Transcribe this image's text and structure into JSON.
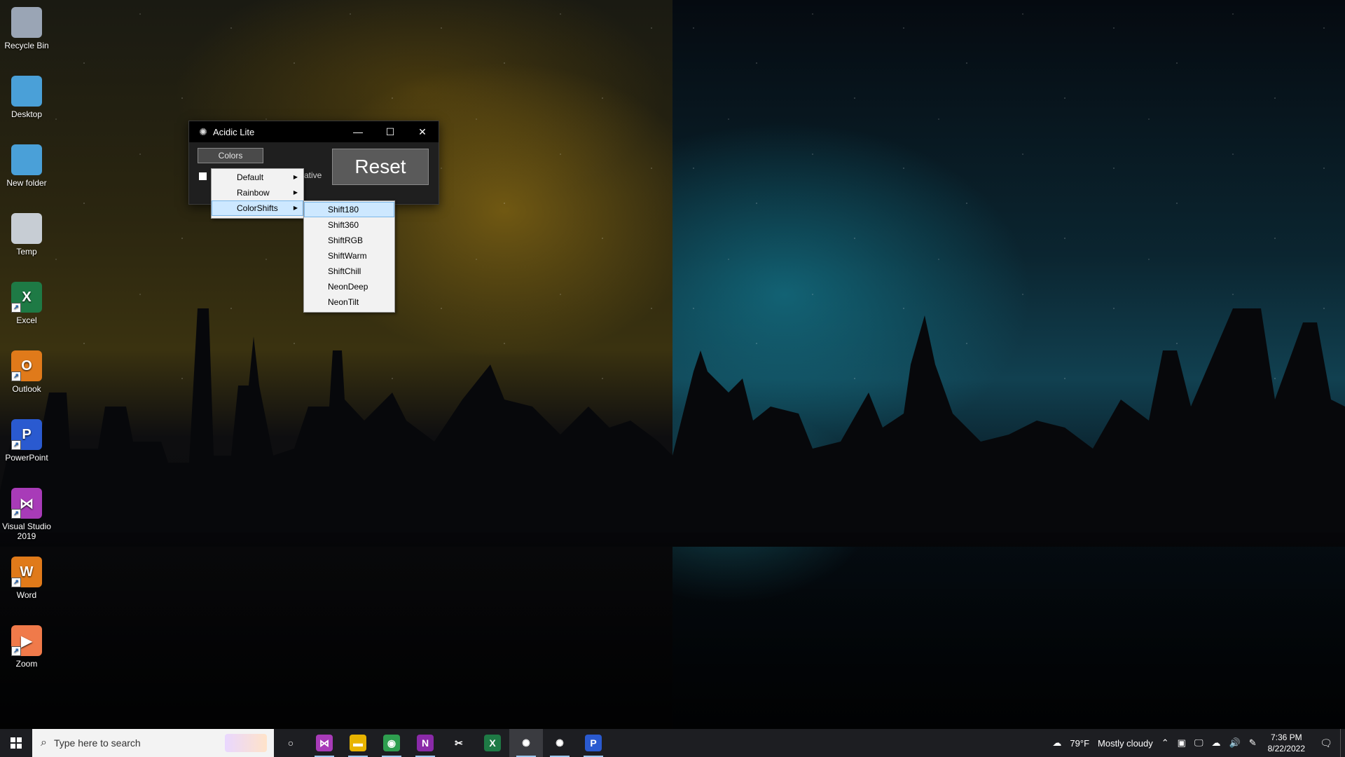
{
  "desktop": {
    "icons": [
      {
        "label": "Recycle Bin",
        "icon": "recycle-bin-icon",
        "color": "#9aa5b5"
      },
      {
        "label": "Desktop",
        "icon": "folder-icon",
        "color": "#4aa0d8"
      },
      {
        "label": "New folder",
        "icon": "folder-icon",
        "color": "#4aa0d8"
      },
      {
        "label": "Temp",
        "icon": "folder-icon",
        "color": "#c7cdd4"
      },
      {
        "label": "Excel",
        "icon": "excel-icon",
        "color": "#1e7a45",
        "glyph": "X"
      },
      {
        "label": "Outlook",
        "icon": "outlook-icon",
        "color": "#e07a1a",
        "glyph": "O"
      },
      {
        "label": "PowerPoint",
        "icon": "powerpoint-icon",
        "color": "#2a5ad0",
        "glyph": "P"
      },
      {
        "label": "Visual Studio\n2019",
        "icon": "visual-studio-icon",
        "color": "#a83bb8",
        "glyph": "⋈"
      },
      {
        "label": "Word",
        "icon": "word-icon",
        "color": "#e07a1a",
        "glyph": "W"
      },
      {
        "label": "Zoom",
        "icon": "zoom-icon",
        "color": "#f07a4a",
        "glyph": "▶"
      }
    ]
  },
  "window": {
    "title": "Acidic Lite",
    "app_icon": "acidic-lite-icon",
    "minimize_glyph": "—",
    "maximize_glyph": "☐",
    "close_glyph": "✕",
    "colors_button": "Colors",
    "negative_label": "ative",
    "negative_checked": false,
    "reset_button": "Reset"
  },
  "menu_colors": {
    "items": [
      {
        "label": "Default",
        "has_submenu": true,
        "selected": false
      },
      {
        "label": "Rainbow",
        "has_submenu": true,
        "selected": false
      },
      {
        "label": "ColorShifts",
        "has_submenu": true,
        "selected": true
      }
    ]
  },
  "menu_colorshifts": {
    "items": [
      {
        "label": "Shift180",
        "selected": true
      },
      {
        "label": "Shift360",
        "selected": false
      },
      {
        "label": "ShiftRGB",
        "selected": false
      },
      {
        "label": "ShiftWarm",
        "selected": false
      },
      {
        "label": "ShiftChill",
        "selected": false
      },
      {
        "label": "NeonDeep",
        "selected": false
      },
      {
        "label": "NeonTilt",
        "selected": false
      }
    ]
  },
  "taskbar": {
    "search_placeholder": "Type here to search",
    "apps": [
      {
        "name": "cortana",
        "icon": "cortana-icon",
        "glyph": "○",
        "color": "transparent",
        "active": false
      },
      {
        "name": "visual-studio",
        "icon": "visual-studio-icon",
        "glyph": "⋈",
        "color": "#a83bb8",
        "active": true
      },
      {
        "name": "file-explorer",
        "icon": "file-explorer-icon",
        "glyph": "▬",
        "color": "#e8b400",
        "active": true
      },
      {
        "name": "chrome",
        "icon": "chrome-icon",
        "glyph": "◉",
        "color": "#2e9e4f",
        "active": true
      },
      {
        "name": "onenote",
        "icon": "onenote-icon",
        "glyph": "N",
        "color": "#8a2aa8",
        "active": true
      },
      {
        "name": "snipping-tool",
        "icon": "snipping-tool-icon",
        "glyph": "✂",
        "color": "transparent",
        "active": false
      },
      {
        "name": "excel",
        "icon": "excel-icon",
        "glyph": "X",
        "color": "#1e7a45",
        "active": false
      },
      {
        "name": "acidic-lite",
        "icon": "acidic-lite-icon",
        "glyph": "✺",
        "color": "transparent",
        "active": true,
        "focused": true
      },
      {
        "name": "acidic",
        "icon": "acidic-icon",
        "glyph": "✺",
        "color": "transparent",
        "active": true
      },
      {
        "name": "powerpoint",
        "icon": "powerpoint-icon",
        "glyph": "P",
        "color": "#2a5ad0",
        "active": true
      }
    ],
    "weather_icon": "weather-cloudy-icon",
    "weather_temp": "79°F",
    "weather_desc": "Mostly cloudy",
    "time": "7:36 PM",
    "date": "8/22/2022"
  }
}
